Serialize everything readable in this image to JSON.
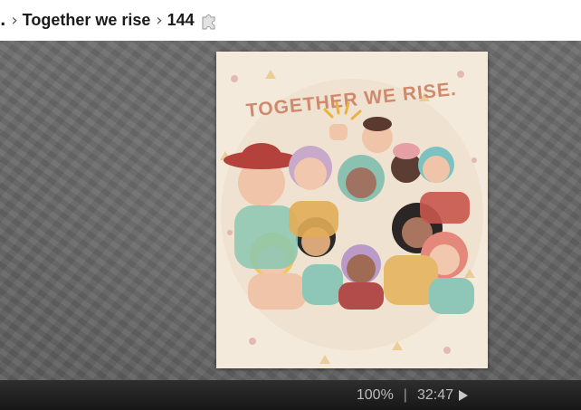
{
  "breadcrumb": {
    "ellipsis": ".",
    "collection": "Together we rise",
    "piece_count": "144"
  },
  "puzzle": {
    "heading": "TOGETHER WE RISE."
  },
  "status": {
    "zoom": "100%",
    "divider": "|",
    "time": "32:47"
  }
}
